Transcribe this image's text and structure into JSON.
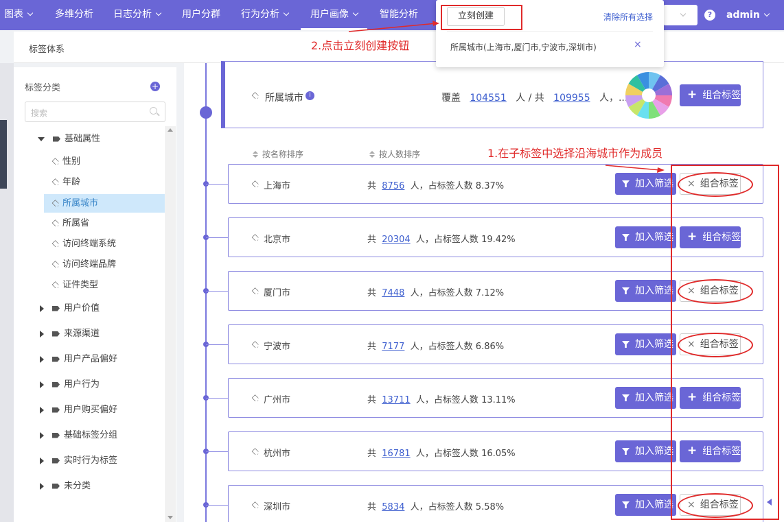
{
  "nav": {
    "items": [
      {
        "label": "图表",
        "caret": true
      },
      {
        "label": "多维分析",
        "caret": false
      },
      {
        "label": "日志分析",
        "caret": true
      },
      {
        "label": "用户分群",
        "caret": false
      },
      {
        "label": "行为分析",
        "caret": true
      },
      {
        "label": "用户画像",
        "caret": true
      },
      {
        "label": "智能分析",
        "caret": false
      }
    ],
    "active": "用户画像",
    "help": "?",
    "user": "admin"
  },
  "breadcrumb": "标签体系",
  "sidebar": {
    "title": "标签分类",
    "add": "+",
    "search_placeholder": "搜索",
    "groups": [
      {
        "label": "基础属性",
        "expanded": true,
        "children": [
          "性别",
          "年龄",
          "所属城市",
          "所属省",
          "访问终端系统",
          "访问终端品牌",
          "证件类型"
        ],
        "active_child": "所属城市"
      },
      {
        "label": "用户价值",
        "expanded": false
      },
      {
        "label": "来源渠道",
        "expanded": false
      },
      {
        "label": "用户产品偏好",
        "expanded": false
      },
      {
        "label": "用户行为",
        "expanded": false
      },
      {
        "label": "用户购买偏好",
        "expanded": false
      },
      {
        "label": "基础标签分组",
        "expanded": false
      },
      {
        "label": "实时行为标签",
        "expanded": false
      },
      {
        "label": "未分类",
        "expanded": false
      }
    ]
  },
  "parent": {
    "label": "所属城市",
    "info": "i",
    "cover_prefix": "覆盖",
    "covered": "104551",
    "mid": "人 / 共",
    "total": "109955",
    "suffix": "人，...",
    "button": "组合标签",
    "pie_colors": [
      "#6fc3f0",
      "#5a6fd8",
      "#9b6fd8",
      "#f07ab0",
      "#e8a0e8",
      "#7fe07a",
      "#6ae0f0",
      "#c7e66a",
      "#c8a0f0",
      "#f0d060",
      "#30c0a0",
      "#3a90e0"
    ]
  },
  "sort": {
    "by_name": "按名称排序",
    "by_count": "按人数排序"
  },
  "children": [
    {
      "name": "上海市",
      "prefix": "共",
      "count": "8756",
      "mid": "人，占标签人数",
      "pct": "8.37%",
      "filter": "加入筛选",
      "combine": "组合标签",
      "selected": true
    },
    {
      "name": "北京市",
      "prefix": "共",
      "count": "20304",
      "mid": "人，占标签人数",
      "pct": "19.42%",
      "filter": "加入筛选",
      "combine": "组合标签",
      "selected": false
    },
    {
      "name": "厦门市",
      "prefix": "共",
      "count": "7448",
      "mid": "人，占标签人数",
      "pct": "7.12%",
      "filter": "加入筛选",
      "combine": "组合标签",
      "selected": true
    },
    {
      "name": "宁波市",
      "prefix": "共",
      "count": "7177",
      "mid": "人，占标签人数",
      "pct": "6.86%",
      "filter": "加入筛选",
      "combine": "组合标签",
      "selected": true
    },
    {
      "name": "广州市",
      "prefix": "共",
      "count": "13711",
      "mid": "人，占标签人数",
      "pct": "13.11%",
      "filter": "加入筛选",
      "combine": "组合标签",
      "selected": false
    },
    {
      "name": "杭州市",
      "prefix": "共",
      "count": "16781",
      "mid": "人，占标签人数",
      "pct": "16.05%",
      "filter": "加入筛选",
      "combine": "组合标签",
      "selected": false
    },
    {
      "name": "深圳市",
      "prefix": "共",
      "count": "5834",
      "mid": "人，占标签人数",
      "pct": "5.58%",
      "filter": "加入筛选",
      "combine": "组合标签",
      "selected": true
    }
  ],
  "dropdown": {
    "create": "立刻创建",
    "clear": "清除所有选择",
    "selected_text": "所属城市(上海市,厦门市,宁波市,深圳市)",
    "remove": "×"
  },
  "annotations": {
    "step1": "1.在子标签中选择沿海城市作为成员",
    "step2": "2.点击立刻创建按钮",
    "color": "#e02a2a"
  },
  "colors": {
    "accent": "#6a66d6",
    "link": "#3e5fcf",
    "active_bg": "#cfe8fb"
  }
}
